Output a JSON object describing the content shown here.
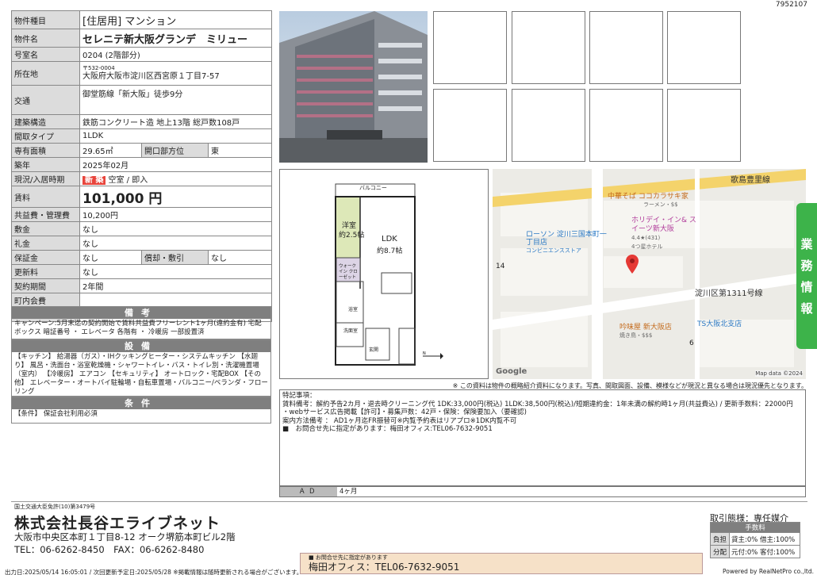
{
  "doc_id": "7952107",
  "property": {
    "type_label": "物件種目",
    "type_value": "[住居用] マンション",
    "name_label": "物件名",
    "name_value": "セレニテ新大阪グランデ　ミリュー",
    "room_label": "号室名",
    "room_value": "0204 (2階部分)",
    "address_label": "所在地",
    "zip": "〒532-0004",
    "address": "大阪府大阪市淀川区西宮原１丁目7-57",
    "traffic_label": "交通",
    "traffic": "御堂筋線「新大阪」徒歩9分",
    "structure_label": "建築構造",
    "structure": "鉄筋コンクリート造 地上13階 総戸数108戸",
    "layout_label": "間取タイプ",
    "layout": "1LDK",
    "area_label": "専有面積",
    "area": "29.65㎡",
    "direction_label": "開口部方位",
    "direction": "東",
    "built_label": "築年",
    "built": "2025年02月",
    "status_label": "現況/入居時期",
    "status_badge": "新 築",
    "status": "空室 / 即入",
    "rent_label": "賃料",
    "rent": "101,000 円",
    "mgmt_label": "共益費・管理費",
    "mgmt": "10,200円",
    "deposit_label": "敷金",
    "deposit": "なし",
    "key_label": "礼金",
    "key": "なし",
    "guarantee_label": "保証金",
    "guarantee": "なし",
    "amort_label": "償却・敷引",
    "amort": "なし",
    "renewal_label": "更新料",
    "renewal": "なし",
    "contract_label": "契約期間",
    "contract": "2年間",
    "town_label": "町内会費",
    "town": "",
    "parking_label": "駐車場",
    "parking": ""
  },
  "remarks": {
    "title": "備考",
    "text": "キャンペーン:5月末迄の契約開始で賃料共益費フリーレント1ヶ月(違約金有) 宅配ボックス 暗証番号 ・ エレベータ 各階有 ・ 冷暖房 一部設置済"
  },
  "facilities": {
    "title": "設備",
    "text": "【キッチン】 給湯器（ガス）・IHクッキングヒーター・システムキッチン 【水廻り】 風呂・洗面台・浴室乾燥機・シャワートイレ・バス・トイレ別・洗濯機置場（室内） 【冷暖房】 エアコン 【セキュリティ】 オートロック・宅配BOX 【その他】 エレベーター・オートバイ駐輪場・自転車置場・バルコニー/ベランダ・フローリング"
  },
  "conditions": {
    "title": "条件",
    "text": "【条件】 保証会社利用必須"
  },
  "floorplan": {
    "balcony": "バルコニー",
    "western": "洋室",
    "western_size": "約2.5帖",
    "ldk": "LDK",
    "ldk_size": "約8.7帖",
    "closet": "ウォークイン クローゼット",
    "bath": "浴室",
    "washroom": "洗面室",
    "entrance": "玄関"
  },
  "map": {
    "road1": "歌島豊里線",
    "road2": "淀川区第1311号線",
    "poi1": "中華そば ココカラサキ家",
    "poi1_sub": "ラーメン・$$",
    "poi2": "ローソン 淀川三国本町一丁目店",
    "poi2_sub": "コンビニエンスストア",
    "poi3": "ホリデイ・イン& スイーツ新大阪",
    "poi3_rating": "4.4★(431)",
    "poi3_sub": "4つ星ホテル",
    "poi4": "吟味屋 新大阪店",
    "poi4_sub": "焼き鳥・$$$",
    "poi5": "TS大阪北支店",
    "num14": "14",
    "num6": "6",
    "google": "Google",
    "mapdata": "Map data ©2024"
  },
  "disclaimer": "※ この資料は物件の概略紹介資料になります。写真、間取図面、設備、模様などが現況と異なる場合は現況優先となります。",
  "notes": [
    "特記事項：",
    "賃料備考：解約予告2カ月・退去時クリーニング代 1DK:33,000円(税込) 1LDK:38,500円(税込)/短期違約金：1年未満の解約時1ヶ月(共益費込) / 更新手数料：22000円",
    "・webサービス広告掲載【許可】・募集戸数：42戸・保険：保険要加入（要確認)",
    "案内方法備考 ： AD1ヶ月迄FR振替可※内覧予約表はリアプロ※1DK内覧不可",
    "■　お問合せ先に指定があります：梅田オフィス:TEL06-7632-9051"
  ],
  "ad": {
    "label": "ＡＤ",
    "value": "4ヶ月"
  },
  "side_tab": [
    "業",
    "務",
    "情",
    "報"
  ],
  "company": {
    "license": "国土交通大臣免許(10)第3479号",
    "name": "株式会社長谷エライブネット",
    "address": "大阪市中央区本町１丁目8-12 オーク堺筋本町ビル2階",
    "tel": "TEL：06-6262-8450　FAX：06-6262-8480"
  },
  "contact": {
    "small": "■ お問合せ先に指定があります",
    "big": "梅田オフィス：TEL06-7632-9051"
  },
  "transaction": {
    "label": "取引態様：専任媒介",
    "fee_title": "手数料",
    "burden_label": "負担",
    "burden": "貸主:0% 借主:100%",
    "split_label": "分配",
    "split": "元付:0% 客付:100%"
  },
  "footer": "出力日:2025/05/14 16:05:01 / 次回更新予定日:2025/05/28 ※掲載情報は随時更新される場合がございます。",
  "powered": "Powered by RealNetPro co.,ltd.",
  "colors": {
    "label_bg": "#dcdcdc",
    "header_bg": "#7f7f7f",
    "side_tab": "#3db34a",
    "new_badge": "#e8453c",
    "contact_bg": "#f6e1c8"
  }
}
